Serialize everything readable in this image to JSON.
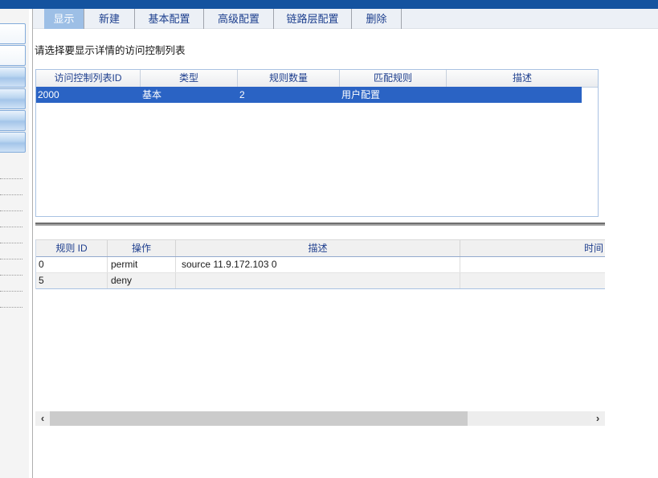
{
  "tabs": [
    {
      "label": "显示",
      "active": true
    },
    {
      "label": "新建",
      "active": false
    },
    {
      "label": "基本配置",
      "active": false
    },
    {
      "label": "高级配置",
      "active": false
    },
    {
      "label": "链路层配置",
      "active": false
    },
    {
      "label": "删除",
      "active": false
    }
  ],
  "hint": "请选择要显示详情的访问控制列表",
  "acl_table": {
    "headers": [
      "访问控制列表ID",
      "类型",
      "规则数量",
      "匹配规则",
      "描述"
    ],
    "rows": [
      {
        "id": "2000",
        "type": "基本",
        "rule_count": "2",
        "match": "用户配置",
        "desc": ""
      }
    ],
    "selected_row_index": 0
  },
  "rule_table": {
    "headers": [
      "规则 ID",
      "操作",
      "描述",
      "时间"
    ],
    "rows": [
      {
        "id": "0",
        "action": "permit",
        "desc": "source 11.9.172.103 0",
        "time": ""
      },
      {
        "id": "5",
        "action": "deny",
        "desc": "",
        "time": ""
      }
    ]
  },
  "scrollbar": {
    "left_arrow": "‹",
    "right_arrow": "›"
  },
  "colors": {
    "topbar": "#14539F",
    "tab_active_bg": "#9DBFE6",
    "tab_text": "#1D3F8E",
    "selected_row_bg": "#2A63C4",
    "table_header_text": "#20408F",
    "table_border": "#A9C2E2"
  }
}
